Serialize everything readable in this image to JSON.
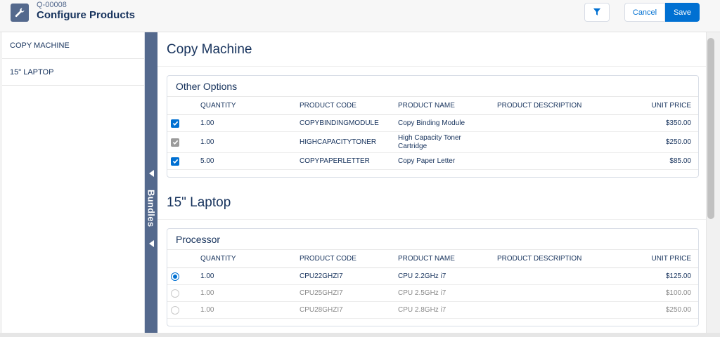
{
  "header": {
    "record_id": "Q-00008",
    "title": "Configure Products",
    "icon": "wrench-icon",
    "filter_icon": "filter-icon",
    "cancel_label": "Cancel",
    "save_label": "Save"
  },
  "nav": {
    "items": [
      {
        "label": "COPY MACHINE"
      },
      {
        "label": "15\" LAPTOP"
      }
    ]
  },
  "bundles_bar": {
    "label": "Bundles"
  },
  "columns": {
    "quantity": "QUANTITY",
    "product_code": "PRODUCT CODE",
    "product_name": "PRODUCT NAME",
    "product_description": "PRODUCT DESCRIPTION",
    "unit_price": "UNIT PRICE"
  },
  "sections": [
    {
      "title": "Copy Machine",
      "group": "Other Options",
      "selection": "checkbox",
      "rows": [
        {
          "selected": true,
          "disabled": false,
          "quantity": "1.00",
          "code": "COPYBINDINGMODULE",
          "name": "Copy Binding Module",
          "description": "",
          "price": "$350.00"
        },
        {
          "selected": true,
          "disabled": true,
          "quantity": "1.00",
          "code": "HIGHCAPACITYTONER",
          "name": "High Capacity Toner Cartridge",
          "description": "",
          "price": "$250.00"
        },
        {
          "selected": true,
          "disabled": false,
          "quantity": "5.00",
          "code": "COPYPAPERLETTER",
          "name": "Copy Paper Letter",
          "description": "",
          "price": "$85.00"
        }
      ]
    },
    {
      "title": "15\" Laptop",
      "group": "Processor",
      "selection": "radio",
      "rows": [
        {
          "selected": true,
          "quantity": "1.00",
          "code": "CPU22GHZI7",
          "name": "CPU 2.2GHz i7",
          "description": "",
          "price": "$125.00"
        },
        {
          "selected": false,
          "quantity": "1.00",
          "code": "CPU25GHZI7",
          "name": "CPU 2.5GHz i7",
          "description": "",
          "price": "$100.00"
        },
        {
          "selected": false,
          "quantity": "1.00",
          "code": "CPU28GHZI7",
          "name": "CPU 2.8GHz i7",
          "description": "",
          "price": "$250.00"
        }
      ]
    }
  ],
  "colors": {
    "brand_blue": "#0070d2",
    "bundles_bar": "#54698d",
    "text_dark": "#16325c"
  }
}
